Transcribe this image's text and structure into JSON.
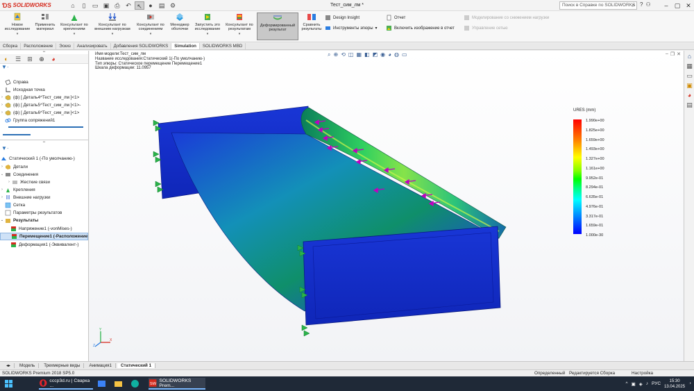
{
  "app": {
    "logo_text": "SOLIDWORKS",
    "doc_title": "Тест_сим_лм *",
    "search_placeholder": "Поиск в Справке по SOLIDWORKS"
  },
  "ribbon": {
    "buttons": [
      {
        "label": "Новое исследование"
      },
      {
        "label": "Применить материал"
      },
      {
        "label": "Консультант по креплениям"
      },
      {
        "label": "Консультант по внешним нагрузкам"
      },
      {
        "label": "Консультант по соединениям"
      },
      {
        "label": "Менеджер оболочки"
      },
      {
        "label": "Запустить это исследование"
      },
      {
        "label": "Консультант по результатам"
      },
      {
        "label": "Деформированный результат"
      },
      {
        "label": "Сравнить результаты"
      }
    ],
    "small": {
      "design_insight": "Design Insight",
      "plot_tools": "Инструменты эпюры",
      "report": "Отчет",
      "include_image": "Включить изображение в отчет",
      "reduced_sim": "Моделирование со снижением нагрузки",
      "mesh_control": "Управление сетью"
    }
  },
  "tabs": [
    "Сборка",
    "Расположение",
    "Эскиз",
    "Анализировать",
    "Добавления SOLIDWORKS",
    "Simulation",
    "SOLIDWORKS MBD"
  ],
  "tree_top": [
    {
      "label": "Справа"
    },
    {
      "label": "Исходная точка"
    },
    {
      "label": "(ф) [ Деталь4^Тест_сим_лм ]<1>"
    },
    {
      "label": "(ф) [ Деталь5^Тест_сим_лм ]<1>-"
    },
    {
      "label": "(ф) [ Деталь6^Тест_сим_лм ]<1>"
    },
    {
      "label": "Группа сопряжений1"
    }
  ],
  "tree_sim": {
    "study": "Статический 1 (-По умолчанию-)",
    "items": [
      {
        "label": "Детали"
      },
      {
        "label": "Соединения"
      },
      {
        "label": "Жесткие связи"
      },
      {
        "label": "Крепления"
      },
      {
        "label": "Внешние нагрузки"
      },
      {
        "label": "Сетка"
      },
      {
        "label": "Параметры результатов"
      },
      {
        "label": "Результаты"
      },
      {
        "label": "Напряжение1 (-vonMises-)"
      },
      {
        "label": "Перемещение1 (-Расположение-)"
      },
      {
        "label": "Деформация1 (-Эквивалент-)"
      }
    ]
  },
  "study_info": {
    "line1": "Имя модели:Тест_сим_лм",
    "line2": "Название исследования:Статический 1(-По умолчанию-)",
    "line3": "Тип эпюры: Статическое перемещение Перемещение1",
    "line4": "Шкала деформации: 11.0957"
  },
  "legend": {
    "title": "URES (mm)",
    "labels": [
      "1.990e+00",
      "1.825e+00",
      "1.659e+00",
      "1.493e+00",
      "1.327e+00",
      "1.161e+00",
      "9.952e-01",
      "8.294e-01",
      "6.635e-01",
      "4.976e-01",
      "3.317e-01",
      "1.659e-01",
      "1.000e-30"
    ]
  },
  "bottom_tabs": [
    "Модель",
    "Трехмерные виды",
    "Анимация1",
    "Статический 1"
  ],
  "status": {
    "product": "SOLIDWORKS Premium 2018 SP5.0",
    "defined": "Определенный",
    "editing": "Редактируется Сборка",
    "custom": "Настройка"
  },
  "taskbar": {
    "item1": "cccp3d.ru | Сварка ...",
    "item2": "SOLIDWORKS Prem...",
    "lang": "РУС",
    "time": "15:30",
    "date": "13.04.2025"
  },
  "colors": {
    "brand_red": "#d52b1e",
    "model_blue": "#1a2fd8",
    "load_arrow": "#c000c0",
    "fixture_green": "#2bb34a"
  }
}
